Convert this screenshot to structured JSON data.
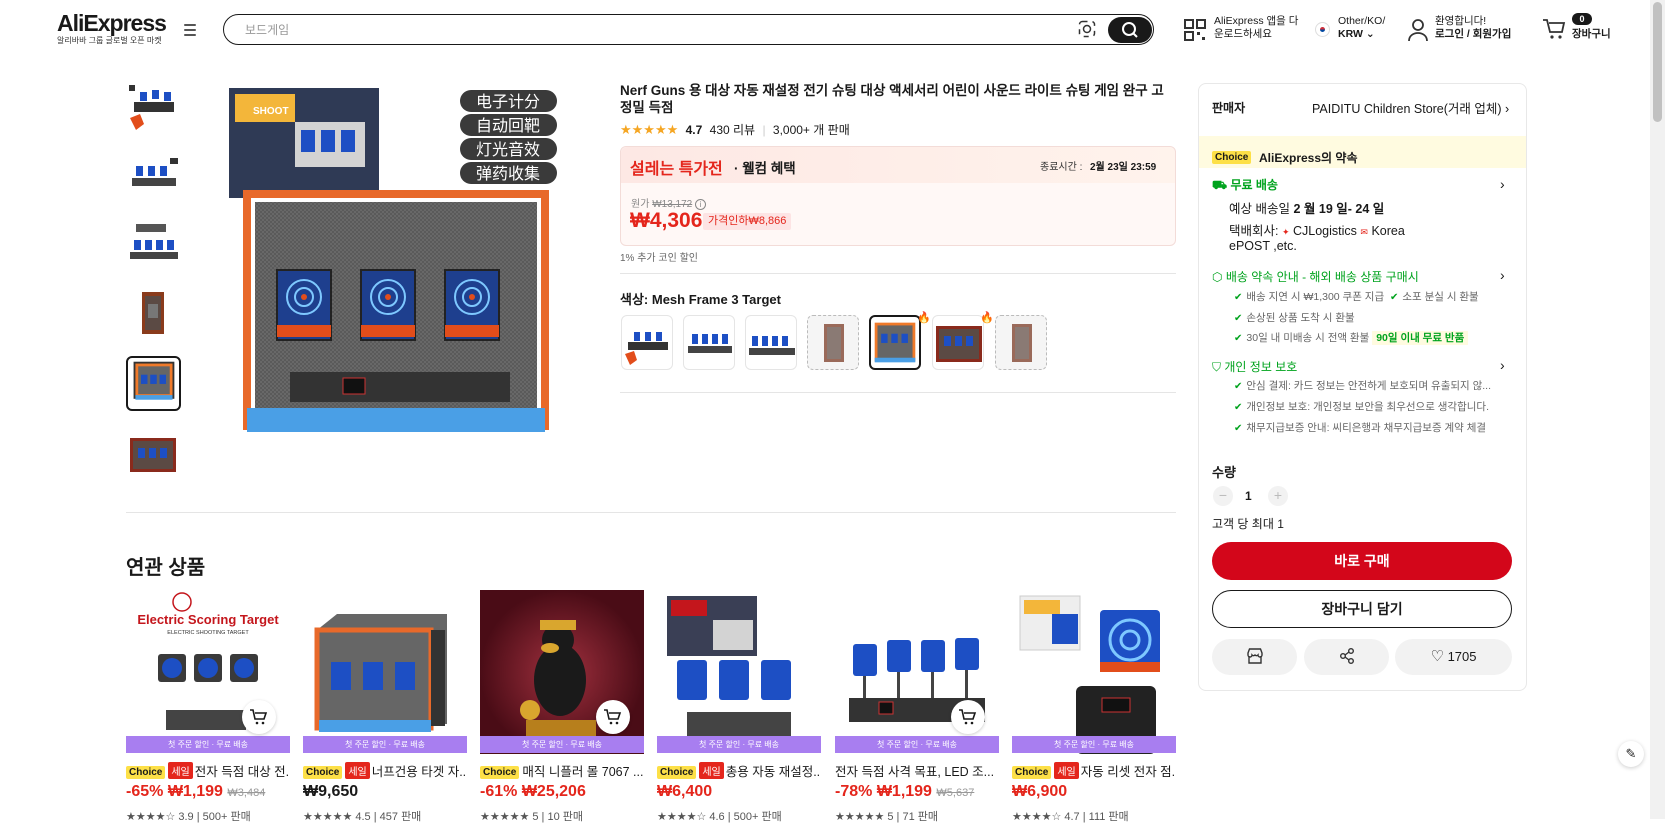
{
  "header": {
    "logo": "AliExpress",
    "logo_sub": "알리바바 그룹 글로벌 오픈 마켓",
    "search_placeholder": "보드게임",
    "app_line1": "AliExpress 앱을 다",
    "app_line2": "운로드하세요",
    "region_line1": "Other/KO/",
    "region_line2": "KRW",
    "account_line1": "환영합니다!",
    "account_line2": "로그인 / 회원가입",
    "cart_count": "0",
    "cart_label": "장바구니"
  },
  "product": {
    "title": "Nerf Guns 용 대상 자동 재설정 전기 슈팅 대상 액세서리 어린이 사운드 라이트 슈팅 게임 완구 고정밀 득점",
    "rating": "4.7",
    "reviews": "430 리뷰",
    "sold": "3,000+ 개 판매",
    "promo_title": "설레는 특가전",
    "promo_sub": "· 웰컴 혜택",
    "end_label": "종료시간 :",
    "end_time": "2월 23일 23:59",
    "orig_label": "원가",
    "orig_price": "₩13,172",
    "price": "₩4,306",
    "discount_badge": "가격인하₩8,866",
    "coin_note": "1% 추가 코인 할인",
    "color_label": "색상: Mesh Frame 3 Target",
    "box_text": [
      "电子计分",
      "自动回靶",
      "灯光音效",
      "弹药收集"
    ]
  },
  "panel": {
    "seller_label": "판매자",
    "seller_name": "PAIDITU Children Store(거래 업체)",
    "choice_tag": "Choice",
    "promise": "AliExpress의 약속",
    "free_ship": "무료 배송",
    "delivery_prefix": "예상 배송일",
    "delivery_date": "2 월 19 일- 24 일",
    "carrier_label": "택배회사:",
    "carrier1": "CJLogistics",
    "carrier2": "Korea",
    "carrier3": "ePOST ,etc.",
    "ship_promise": "배송 약속 안내 - 해외 배송 상품 구매시",
    "sp1": "배송 지연 시 ₩1,300 쿠폰 지급",
    "sp2": "소포 분실 시 환불",
    "sp3": "손상된 상품 도착 시 환불",
    "sp4": "30일 내 미배송 시 전액 환불",
    "sp4_badge": "90일 이내 무료 반품",
    "privacy": "개인 정보 보호",
    "pv1": "안심 결제: 카드 정보는 안전하게 보호되며 유출되지 않...",
    "pv2": "개인정보 보호: 개인정보 보안을 최우선으로 생각합니다.",
    "pv3": "채무지급보증 안내: 씨티은행과 채무지급보증 계약 체결",
    "qty_label": "수량",
    "qty": "1",
    "max_note": "고객 당 최대 1",
    "buy_now": "바로 구매",
    "add_cart": "장바구니 담기",
    "wish_count": "1705"
  },
  "related": {
    "heading": "연관 상품",
    "strip": "첫 주문 할인 · 무료 배송",
    "items": [
      {
        "choice": "Choice",
        "sale": "세일",
        "title": "전자 득점 대상 전...",
        "discount": "-65%",
        "price": "₩1,199",
        "old": "₩3,484",
        "stars": "★★★★☆",
        "rating": "3.9",
        "sold": "500+ 판매"
      },
      {
        "choice": "Choice",
        "sale": "세일",
        "title": "너프건용 타겟 자...",
        "discount": "",
        "price": "₩9,650",
        "old": "",
        "stars": "★★★★★",
        "rating": "4.5",
        "sold": "457 판매"
      },
      {
        "choice": "Choice",
        "sale": "세일",
        "title": "매직 니플러 몰 7067 ...",
        "discount": "-61%",
        "price": "₩25,206",
        "old": "",
        "stars": "★★★★★",
        "rating": "5",
        "sold": "10 판매"
      },
      {
        "choice": "Choice",
        "sale": "세일",
        "title": "총용 자동 재설정...",
        "discount": "",
        "price": "₩6,400",
        "old": "",
        "stars": "★★★★☆",
        "rating": "4.6",
        "sold": "500+ 판매"
      },
      {
        "choice": "",
        "sale": "",
        "title": "전자 득점 사격 목표, LED 조...",
        "discount": "-78%",
        "price": "₩1,199",
        "old": "₩5,637",
        "stars": "★★★★★",
        "rating": "5",
        "sold": "71 판매"
      },
      {
        "choice": "Choice",
        "sale": "세일",
        "title": "자동 리셋 전자 점...",
        "discount": "",
        "price": "₩6,900",
        "old": "",
        "stars": "★★★★☆",
        "rating": "4.7",
        "sold": "111 판매"
      }
    ],
    "card1_img_text": "Electric Scoring Target",
    "card1_img_sub": "ELECTRIC SHOOTING TARGET"
  },
  "colors": {
    "accent": "#d3061a",
    "green": "#00a31d",
    "choice": "#fde047",
    "strip": "#a87ef0"
  }
}
